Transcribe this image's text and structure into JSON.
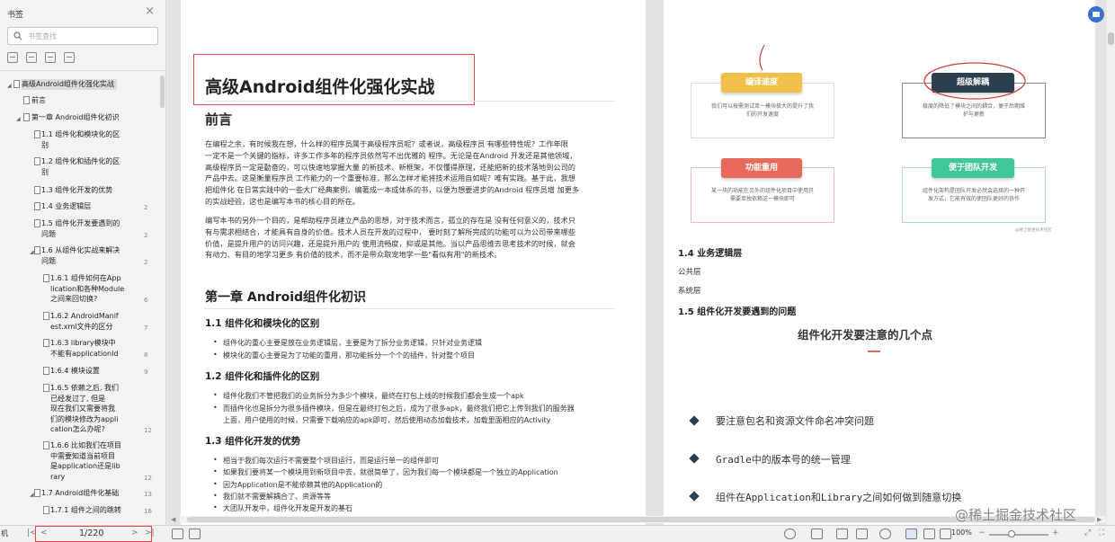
{
  "sidebar": {
    "title": "书签",
    "search_placeholder": "书签查找",
    "toc": [
      {
        "text": "高级Android组件化强化实战"
      },
      {
        "text": "前言"
      },
      {
        "text": "第一章 Android组件化初识"
      },
      {
        "text": "1.1 组件化和模块化的区\n别"
      },
      {
        "text": "1.2 组件化和插件化的区\n别"
      },
      {
        "text": "1.3 组件化开发的优势"
      },
      {
        "text": "1.4 业务逻辑层",
        "page": "2"
      },
      {
        "text": "1.5 组件化开发要遇到的\n问题",
        "page": "2"
      },
      {
        "text": "1.6 从组件化实战来解决\n问题",
        "page": "2"
      },
      {
        "text": "1.6.1 组件如何在App\nlication和各种Module\n之间来回切换?",
        "page": "6"
      },
      {
        "text": "1.6.2 AndroidManif\nest.xml文件的区分",
        "page": "7"
      },
      {
        "text": "1.6.3 library模块中\n不能有applicationId",
        "page": "8"
      },
      {
        "text": "1.6.4 模块设置",
        "page": "9"
      },
      {
        "text": "1.6.5 依赖之后, 我们\n已经发过了, 但是\n现在我们又需要将我\n们的模块修改为appli\ncation怎么办呢?",
        "page": "12"
      },
      {
        "text": "1.6.6 比如我们在项目\n中需要知道当前项目\n是application还是lib\nrary",
        "page": "12"
      },
      {
        "text": "1.7 Android组件化基础",
        "page": "13"
      },
      {
        "text": "1.7.1 组件之间的跳转",
        "page": "16"
      }
    ]
  },
  "doc": {
    "title": "高级Android组件化强化实战",
    "preface_heading": "前言",
    "preface_p1": [
      "在编程之余，有时候我在想，什么样的程序员属于高级程序员呢？或者说，高级程序员 有哪些特性呢？工作年限",
      "一定不是一个关键的指标，许多工作多年的程序员依然写不出优雅的 程序。无论是在Android 开发还是其他领域，",
      "高级程序员一定是勤奋的，可以快速地掌握大量 的新技术、新框架，不仅懂得原理，还能把新的技术落地到公司的",
      "产品中去。这是衡量程序员 工作能力的一个重要标准，那么怎样才能将技术运用自如呢？唯有实践。基于此，我想",
      "把组件化 在日常实践中的一些大厂经典案例，编著成一本成体系的书，以便为想要进步的Android 程序员增 加更多",
      "的实战经验，这也是编写本书的核心目的所在。"
    ],
    "preface_p2": [
      "编写本书的另外一个目的，是帮助程序员建立产品的思想，对于技术而言，孤立的存在是 没有任何意义的，技术只",
      "有与需求相结合，才能具有自身的价值。技术人员在开发的过程中， 要时刻了解所完成的功能可以为公司带来哪些",
      "价值，是提升用户的访问兴趣，还是提升用户的 使用流畅度，抑或是其他。当以产品思维去思考技术的时候，就会",
      "有动力、有目的地学习更多 有价值的技术，而不是带众取宠地学一些\"看似有用\"的新技术。"
    ],
    "chapter1": "第一章 Android组件化初识",
    "s11": "1.1 组件化和模块化的区别",
    "s11_bullets": [
      "组件化的重心主要是放在业务逻辑层，主要是为了拆分业务逻辑，只针对业务逻辑",
      "模块化的重心主要是为了功能的重用，那功能拆分一个个的插件，针对整个项目"
    ],
    "s12": "1.2 组件化和插件化的区别",
    "s12_b1": "组件化我们不管把我们的业务拆分为多少个模块，最终在打包上线的时候我们都会生成一个apk",
    "s12_b2_l1": "而插件化也是拆分为很多插件模块，但是在最终打包之后，成为了很多apk，最终我们把它上传到我们的服务器",
    "s12_b2_l2": "上面，用户使用的时候，只需要下载响应的apk即可，然后使用动态加载技术，加载里面相应的Activity",
    "s13": "1.3 组件化开发的优势",
    "s13_bullets": [
      "相当于我们每次运行不需要整个项目运行，而是运行单一的组件即可",
      "如果我们要将某一个模块用到新项目中去，就很简单了，因为我们每一个模块都是一个独立的Application",
      "因为Application是不能依赖其他的Application的",
      "我们就不需要解耦合了、资源等等",
      "大团队开发中，组件化开发是开发的基石"
    ],
    "diagram": {
      "b1": "编译速度",
      "c1": "我们可以按需测试单一模块极大的提升了我\n们的开发速度",
      "b2": "超级解耦",
      "c2": "极度的降低了模块之间的耦合，便于后期维\n护与更新",
      "b3": "功能重用",
      "c3": "某一块的功能在另外的组件化项目中使用只\n需要单独依赖这一模块即可",
      "b4": "便于团队开发",
      "c4": "组件化架构是团队开发必然会选择的一种开\n发方式，它能有效的使团队更好的协作",
      "credit": "@稀土掘金技术社区"
    },
    "s14": "1.4 业务逻辑层",
    "s14_items": [
      "公共层",
      "系统层"
    ],
    "s15": "1.5 组件化开发要遇到的问题",
    "points_title": "组件化开发要注意的几个点",
    "points": [
      "要注意包名和资源文件命名冲突问题",
      "Gradle中的版本号的统一管理",
      "组件在Application和Library之间如何做到随意切换"
    ]
  },
  "status": {
    "left_label": "机",
    "page": "1/220",
    "zoom": "100%",
    "watermark": "@稀土掘金技术社区"
  }
}
